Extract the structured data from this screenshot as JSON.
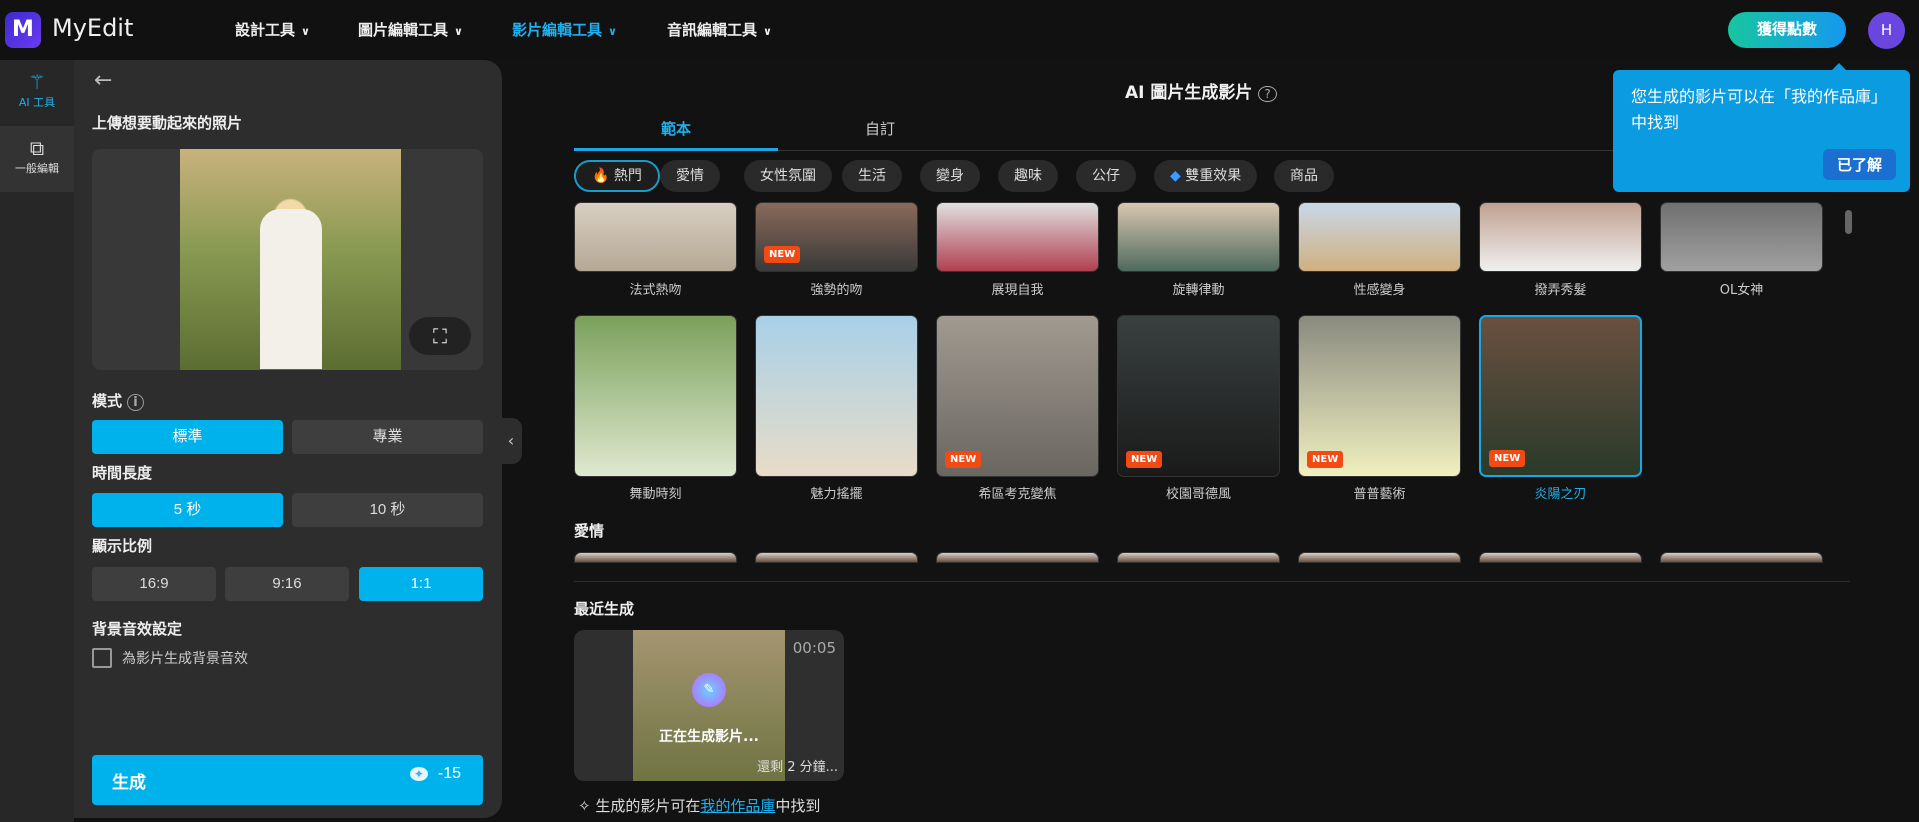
{
  "app": {
    "logo_letter": "M",
    "name": "MyEdit"
  },
  "nav": [
    {
      "label": "設計工具"
    },
    {
      "label": "圖片編輯工具"
    },
    {
      "label": "影片編輯工具",
      "active": true
    },
    {
      "label": "音訊編輯工具"
    }
  ],
  "header": {
    "points_button": "獲得點數",
    "avatar_initial": "H"
  },
  "rail": [
    {
      "label": "AI 工具",
      "icon": "magic-wand-icon"
    },
    {
      "label": "一般編輯",
      "icon": "layers-icon"
    }
  ],
  "panel": {
    "upload_title": "上傳想要動起來的照片",
    "mode_label": "模式",
    "mode_options": [
      "標準",
      "專業"
    ],
    "duration_label": "時間長度",
    "duration_options": [
      "5 秒",
      "10 秒"
    ],
    "ratio_label": "顯示比例",
    "ratio_options": [
      "16:9",
      "9:16",
      "1:1"
    ],
    "audio_label": "背景音效設定",
    "audio_checkbox": "為影片生成背景音效",
    "generate_label": "生成",
    "generate_cost": "-15"
  },
  "main": {
    "title": "AI 圖片生成影片",
    "tabs": [
      "範本",
      "自訂"
    ],
    "chips": [
      "熱門",
      "愛情",
      "女性氛圍",
      "生活",
      "變身",
      "趣味",
      "公仔",
      "雙重效果",
      "商品"
    ],
    "row1": [
      {
        "label": "法式熱吻"
      },
      {
        "label": "強勢的吻",
        "new": true
      },
      {
        "label": "展現自我"
      },
      {
        "label": "旋轉律動"
      },
      {
        "label": "性感變身"
      },
      {
        "label": "撥弄秀髮"
      },
      {
        "label": "OL女神"
      }
    ],
    "row2": [
      {
        "label": "舞動時刻"
      },
      {
        "label": "魅力搖擺"
      },
      {
        "label": "希區考克變焦",
        "new": true
      },
      {
        "label": "校園哥德風",
        "new": true
      },
      {
        "label": "普普藝術",
        "new": true
      },
      {
        "label": "炎陽之刃",
        "new": true,
        "selected": true
      }
    ],
    "new_badge": "NEW",
    "section2": "愛情",
    "recent_title": "最近生成",
    "recent": {
      "duration": "00:05",
      "status": "正在生成影片...",
      "remaining": "還剩 2 分鐘..."
    },
    "footer_pre": "生成的影片可在",
    "footer_link": "我的作品庫",
    "footer_post": "中找到"
  },
  "tooltip": {
    "text": "您生成的影片可以在「我的作品庫」中找到",
    "button": "已了解"
  }
}
